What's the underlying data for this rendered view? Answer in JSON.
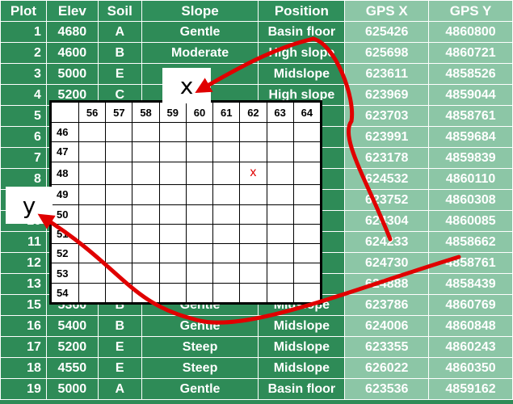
{
  "sheet": {
    "headers": [
      "Plot",
      "Elev",
      "Soil",
      "Slope",
      "Position",
      "GPS X",
      "GPS Y"
    ],
    "rows": [
      [
        "1",
        "4680",
        "A",
        "Gentle",
        "Basin floor",
        "625426",
        "4860800"
      ],
      [
        "2",
        "4600",
        "B",
        "Moderate",
        "High slope",
        "625698",
        "4860721"
      ],
      [
        "3",
        "5000",
        "E",
        "",
        "Midslope",
        "623611",
        "4858526"
      ],
      [
        "4",
        "5200",
        "C",
        "",
        "High slope",
        "623969",
        "4859044"
      ],
      [
        "5",
        "",
        "",
        "",
        "r",
        "623703",
        "4858761"
      ],
      [
        "6",
        "",
        "",
        "",
        "r",
        "623991",
        "4859684"
      ],
      [
        "7",
        "",
        "",
        "",
        "",
        "623178",
        "4859839"
      ],
      [
        "8",
        "",
        "",
        "",
        "",
        "624532",
        "4860110"
      ],
      [
        "",
        "",
        "",
        "",
        "",
        "623752",
        "4860308"
      ],
      [
        "10",
        "",
        "",
        "",
        "",
        "624304",
        "4860085"
      ],
      [
        "11",
        "",
        "",
        "",
        "pe",
        "624233",
        "4858662"
      ],
      [
        "12",
        "",
        "",
        "",
        "pe",
        "624730",
        "4858761"
      ],
      [
        "13",
        "",
        "",
        "",
        "",
        "624888",
        "4858439"
      ],
      [
        "15",
        "5360",
        "B",
        "Gentle",
        "Midslope",
        "623786",
        "4860769"
      ],
      [
        "16",
        "5400",
        "B",
        "Gentle",
        "Midslope",
        "624006",
        "4860848"
      ],
      [
        "17",
        "5200",
        "E",
        "Steep",
        "Midslope",
        "623355",
        "4860243"
      ],
      [
        "18",
        "4550",
        "E",
        "Steep",
        "Midslope",
        "626022",
        "4860350"
      ],
      [
        "19",
        "5000",
        "A",
        "Gentle",
        "Basin floor",
        "623536",
        "4859162"
      ]
    ]
  },
  "grid": {
    "col_labels": [
      "56",
      "57",
      "58",
      "59",
      "60",
      "61",
      "62",
      "63",
      "64"
    ],
    "row_labels": [
      "46",
      "47",
      "48",
      "49",
      "50",
      "51",
      "52",
      "53",
      "54"
    ],
    "mark": {
      "row": "48",
      "col": "62",
      "symbol": "x"
    }
  },
  "axis_labels": {
    "x": "x",
    "y": "y"
  },
  "colors": {
    "sheet_green": "#2e8b57",
    "gps_green": "#8cc6a6",
    "arrow_red": "#e00000"
  }
}
